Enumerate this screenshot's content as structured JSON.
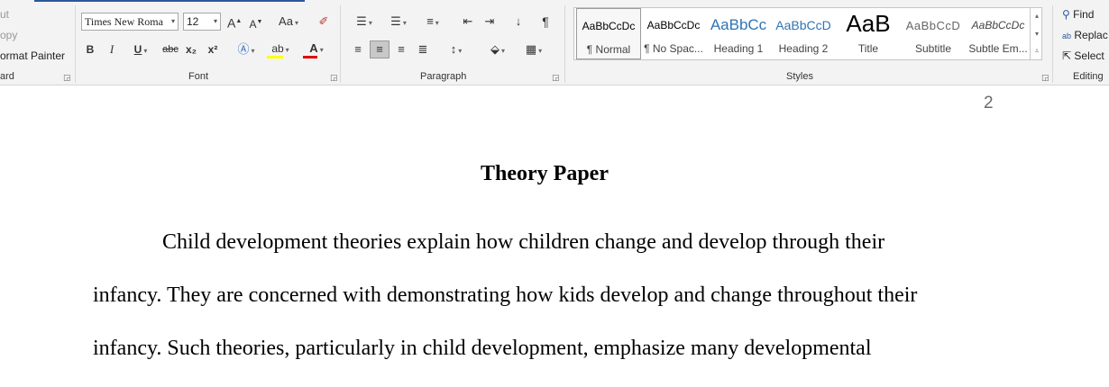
{
  "clipboard": {
    "cut_label": "ut",
    "copy_label": "opy",
    "format_painter_label": "ormat Painter",
    "group_label": "ard"
  },
  "font": {
    "name_value": "Times New Roma",
    "size_value": "12",
    "group_label": "Font",
    "bold": "B",
    "italic": "I",
    "underline": "U",
    "strikethrough": "abc",
    "subscript": "x₂",
    "superscript": "x²",
    "change_case": "Aa",
    "grow": "A",
    "shrink": "A",
    "highlight_color": "#ffff00",
    "font_color": "#e00000"
  },
  "paragraph": {
    "group_label": "Paragraph"
  },
  "styles": {
    "group_label": "Styles",
    "items": [
      {
        "preview": "AaBbCcDc",
        "name": "¶ Normal"
      },
      {
        "preview": "AaBbCcDc",
        "name": "¶ No Spac..."
      },
      {
        "preview": "AaBbCc",
        "name": "Heading 1"
      },
      {
        "preview": "AaBbCcD",
        "name": "Heading 2"
      },
      {
        "preview": "AaB",
        "name": "Title"
      },
      {
        "preview": "AaBbCcD",
        "name": "Subtitle"
      },
      {
        "preview": "AaBbCcDc",
        "name": "Subtle Em..."
      }
    ],
    "heading_color": "#2e74b5"
  },
  "editing": {
    "find_label": "Find",
    "replace_label": "Replac",
    "select_label": "Select",
    "group_label": "Editing"
  },
  "document": {
    "page_number": "2",
    "title": "Theory Paper",
    "lines": [
      "Child development theories explain how children change and develop through their",
      "infancy. They are concerned with demonstrating how kids develop and change throughout their",
      "infancy. Such theories, particularly in child development, emphasize many developmental"
    ]
  }
}
